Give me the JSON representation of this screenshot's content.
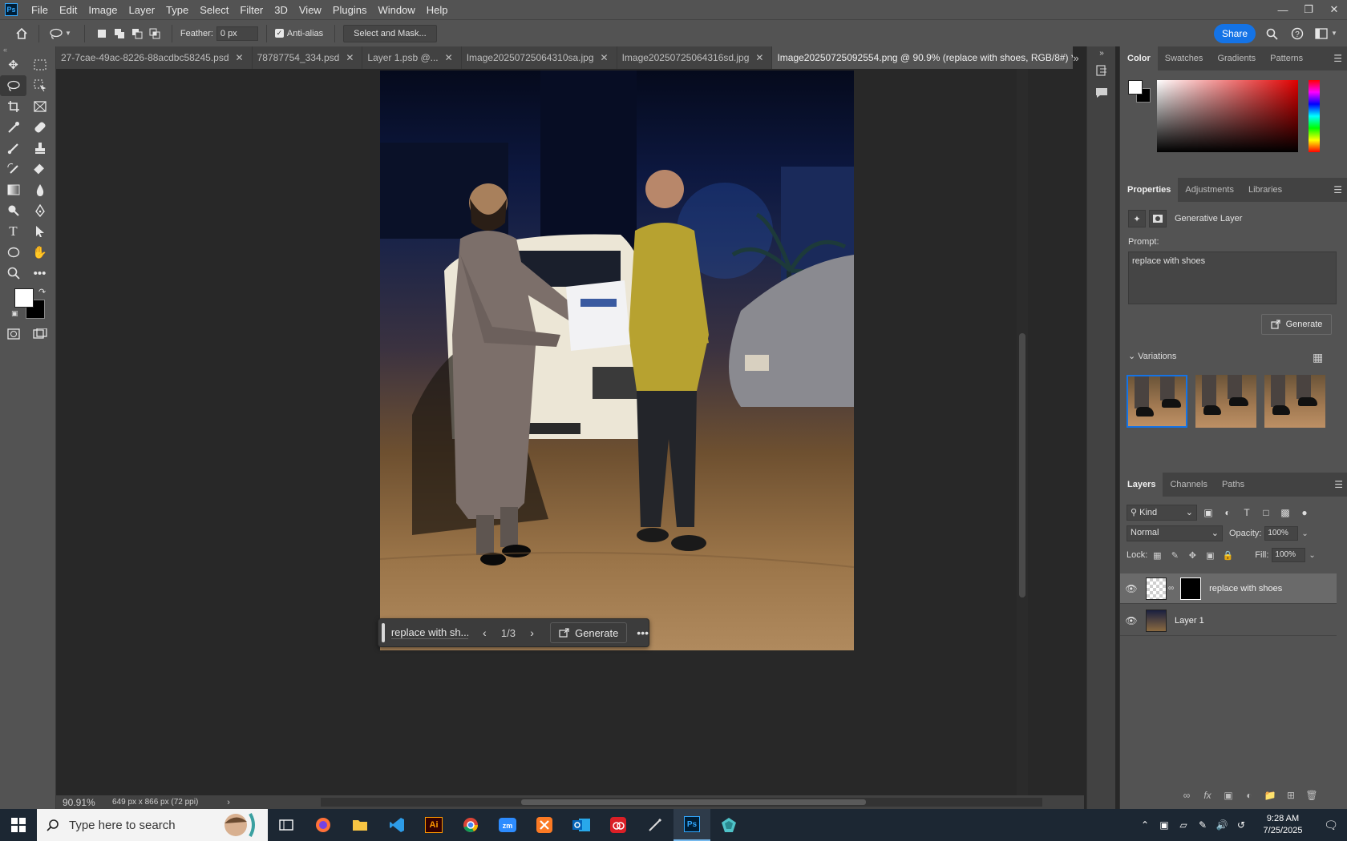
{
  "menu": {
    "logo": "Ps",
    "items": [
      "File",
      "Edit",
      "Image",
      "Layer",
      "Type",
      "Select",
      "Filter",
      "3D",
      "View",
      "Plugins",
      "Window",
      "Help"
    ]
  },
  "options": {
    "feather_label": "Feather:",
    "feather_value": "0 px",
    "antialias_label": "Anti-alias",
    "select_mask_label": "Select and Mask...",
    "share_label": "Share"
  },
  "tabs": [
    {
      "label": "27-7cae-49ac-8226-88acdbc58245.psd",
      "active": false
    },
    {
      "label": "78787754_334.psd",
      "active": false
    },
    {
      "label": "Layer 1.psb @...",
      "active": false
    },
    {
      "label": "Image20250725064310sa.jpg",
      "active": false
    },
    {
      "label": "Image20250725064316sd.jpg",
      "active": false
    },
    {
      "label": "Image20250725092554.png @ 90.9% (replace with shoes, RGB/8#) *",
      "active": true
    }
  ],
  "context_bar": {
    "prompt": "replace with sh...",
    "count": "1/3",
    "generate_label": "Generate"
  },
  "status": {
    "zoom": "90.91%",
    "doc_size": "649 px x 866 px (72 ppi)"
  },
  "color_panel": {
    "tabs": [
      "Color",
      "Swatches",
      "Gradients",
      "Patterns"
    ],
    "active_tab": "Color",
    "foreground": "#ffffff",
    "background": "#000000"
  },
  "properties": {
    "tabs": [
      "Properties",
      "Adjustments",
      "Libraries"
    ],
    "layer_type": "Generative Layer",
    "prompt_label": "Prompt:",
    "prompt_text": "replace with shoes",
    "generate_label": "Generate",
    "variations_label": "Variations",
    "selected_variation": 1
  },
  "layers": {
    "tabs": [
      "Layers",
      "Channels",
      "Paths"
    ],
    "kind_label": "Kind",
    "blend_mode": "Normal",
    "opacity_label": "Opacity:",
    "opacity": "100%",
    "lock_label": "Lock:",
    "fill_label": "Fill:",
    "fill": "100%",
    "items": [
      {
        "name": "replace with shoes",
        "selected": true
      },
      {
        "name": "Layer 1",
        "selected": false
      }
    ]
  },
  "taskbar": {
    "search_placeholder": "Type here to search",
    "apps": [
      "Ai",
      "Ps"
    ],
    "time": "9:28 AM",
    "date": "7/25/2025"
  },
  "colors": {
    "accent": "#1473e6",
    "chrome": "#535353",
    "canvas_bg": "#282828"
  }
}
